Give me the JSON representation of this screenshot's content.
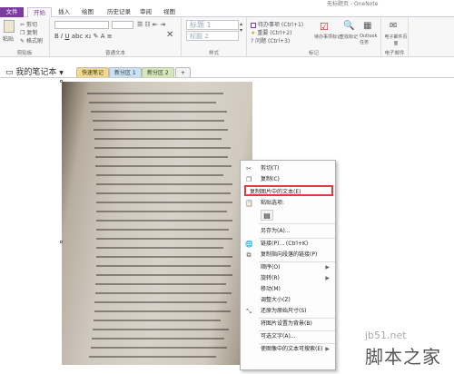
{
  "window": {
    "title": "无标题页 - OneNote"
  },
  "ribbon_tabs": [
    "文件",
    "开始",
    "插入",
    "绘图",
    "历史记录",
    "审阅",
    "视图"
  ],
  "ribbon": {
    "clipboard": {
      "paste": "粘贴",
      "cut": "剪切",
      "copy": "复制",
      "format_painter": "格式刷",
      "group": "剪贴板"
    },
    "basic_text": {
      "group": "普通文本"
    },
    "styles": {
      "heading1": "标题 1",
      "heading2": "标题 2",
      "group": "样式"
    },
    "tags": {
      "todo": "待办事项 (Ctrl+1)",
      "important": "重要 (Ctrl+2)",
      "question": "问题 (Ctrl+3)",
      "todo_tag": "待办事项标记",
      "find_tags": "查找标记",
      "outlook_tasks": "Outlook 任务",
      "group": "标记"
    },
    "email": {
      "label": "电子邮件页面",
      "group": "电子邮件"
    }
  },
  "notebook": {
    "name": "我的笔记本"
  },
  "sections": [
    "快速笔记",
    "新分区 1",
    "新分区 2",
    "+"
  ],
  "context_menu": [
    {
      "label": "剪切(T)",
      "icon": "cut-icon",
      "enabled": true
    },
    {
      "label": "复制(C)",
      "icon": "copy-icon",
      "enabled": true
    },
    {
      "label": "复制图片中的文本(E)",
      "icon": "",
      "enabled": true,
      "highlight": true
    },
    {
      "label": "粘贴选项:",
      "icon": "paste-icon",
      "enabled": true
    },
    {
      "label": "另存为(A)...",
      "icon": "",
      "enabled": true
    },
    {
      "label": "链接(P)...  (Ctrl+K)",
      "icon": "link-icon",
      "enabled": true
    },
    {
      "label": "复制指向段落的链接(P)",
      "icon": "link-paragraph-icon",
      "enabled": true
    },
    {
      "label": "顺序(O)",
      "icon": "",
      "enabled": true,
      "submenu": true
    },
    {
      "label": "旋转(R)",
      "icon": "",
      "enabled": true,
      "submenu": true
    },
    {
      "label": "移动(M)",
      "icon": "",
      "enabled": true
    },
    {
      "label": "调整大小(Z)",
      "icon": "",
      "enabled": true
    },
    {
      "label": "还原为原始尺寸(S)",
      "icon": "restore-icon",
      "enabled": true
    },
    {
      "label": "将图片设置为背景(B)",
      "icon": "",
      "enabled": true
    },
    {
      "label": "可选文字(A)...",
      "icon": "",
      "enabled": true
    },
    {
      "label": "使图像中的文本可搜索(E)",
      "icon": "",
      "enabled": true,
      "submenu": true
    }
  ],
  "watermark": {
    "url": "jb51.net",
    "name": "脚本之家"
  },
  "colors": {
    "accent": "#7b3ba0",
    "highlight_border": "#e0393e"
  }
}
